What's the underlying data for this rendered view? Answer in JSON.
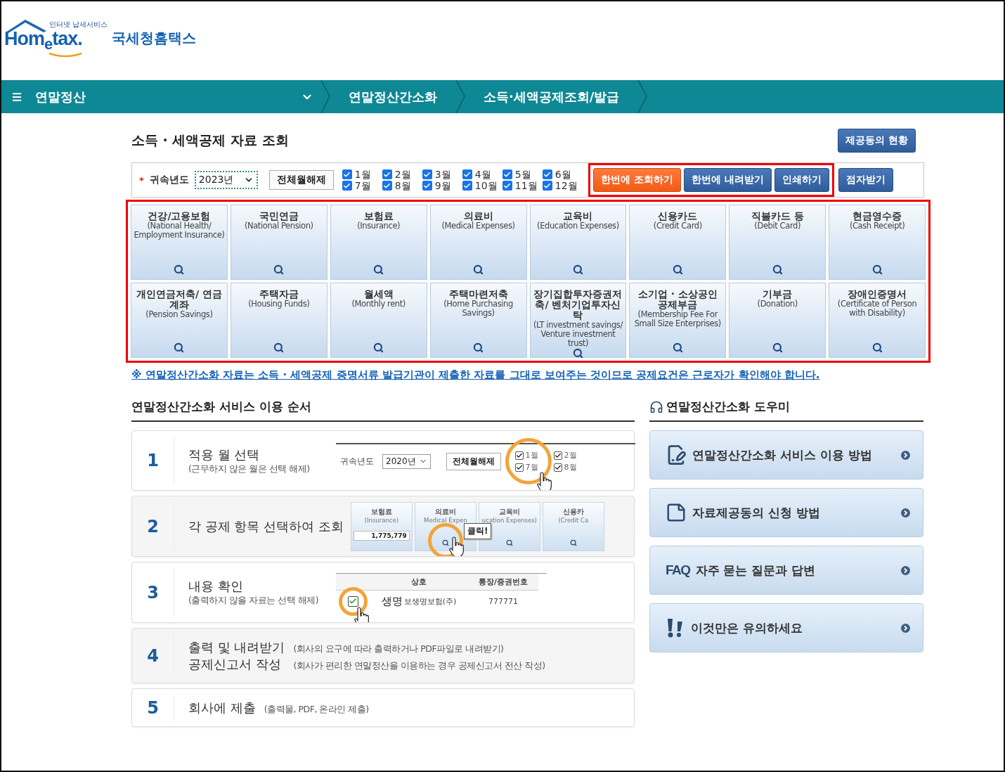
{
  "logo": {
    "tagline": "인터넷 납세서비스",
    "wordmark": "Hom$_{e}$tax.",
    "name": "국세청홈택스"
  },
  "nav": {
    "menu": "연말정산",
    "crumbs": [
      "연말정산간소화",
      "소득·세액공제조회/발급"
    ]
  },
  "page": {
    "title": "소득 · 세액공제 자료 조회",
    "consent_button": "제공동의 현황"
  },
  "filter": {
    "required_mark": "*",
    "year_label": "귀속년도",
    "year": "2023년",
    "reset_button": "전체월해제",
    "months": [
      {
        "label": "1월",
        "checked": true
      },
      {
        "label": "2월",
        "checked": true
      },
      {
        "label": "3월",
        "checked": true
      },
      {
        "label": "4월",
        "checked": true
      },
      {
        "label": "5월",
        "checked": true
      },
      {
        "label": "6월",
        "checked": true
      },
      {
        "label": "7월",
        "checked": true
      },
      {
        "label": "8월",
        "checked": true
      },
      {
        "label": "9월",
        "checked": true
      },
      {
        "label": "10월",
        "checked": true
      },
      {
        "label": "11월",
        "checked": true
      },
      {
        "label": "12월",
        "checked": true
      }
    ],
    "highlighted_actions": [
      {
        "kind": "primary",
        "label": "한번에 조회하기"
      },
      {
        "kind": "secondary",
        "label": "한번에 내려받기"
      },
      {
        "kind": "secondary",
        "label": "인쇄하기"
      }
    ],
    "braille_button": "점자받기"
  },
  "categories": [
    {
      "title": "건강/고용보험",
      "subtitle": "(National Health/ Employment Insurance)"
    },
    {
      "title": "국민연금",
      "subtitle": "(National Pension)"
    },
    {
      "title": "보험료",
      "subtitle": "(Insurance)"
    },
    {
      "title": "의료비",
      "subtitle": "(Medical Expenses)"
    },
    {
      "title": "교육비",
      "subtitle": "(Education Expenses)"
    },
    {
      "title": "신용카드",
      "subtitle": "(Credit Card)"
    },
    {
      "title": "직불카드 등",
      "subtitle": "(Debit Card)"
    },
    {
      "title": "현금영수증",
      "subtitle": "(Cash Receipt)"
    },
    {
      "title": "개인연금저축/ 연금계좌",
      "subtitle": "(Pension Savings)"
    },
    {
      "title": "주택자금",
      "subtitle": "(Housing Funds)"
    },
    {
      "title": "월세액",
      "subtitle": "(Monthly rent)"
    },
    {
      "title": "주택마련저축",
      "subtitle": "(Home Purchasing Savings)"
    },
    {
      "title": "장기집합투자증권저축/ 벤처기업투자신탁",
      "subtitle": "(LT investment savings/ Venture investment trust)"
    },
    {
      "title": "소기업 · 소상공인 공제부금",
      "subtitle": "(Membership Fee For Small Size Enterprises)"
    },
    {
      "title": "기부금",
      "subtitle": "(Donation)"
    },
    {
      "title": "장애인증명서",
      "subtitle": "(Certificate of Person with Disability)"
    }
  ],
  "notice": "※ 연말정산간소화 자료는 소득 · 세액공제 증명서류 발급기관이 제출한 자료를 그대로 보여주는 것이므로 공제요건은 근로자가 확인해야 합니다.",
  "steps_section": {
    "title": "연말정산간소화 서비스 이용 순서",
    "steps": [
      {
        "number": "1",
        "kind": "illustrated",
        "title": "적용 월 선택",
        "note": "(근무하지 않은 월은 선택 해제)",
        "illustration": {
          "kind": "months",
          "year_label": "귀속년도",
          "year": "2020년",
          "reset": "전체월해제",
          "months": [
            {
              "label": "1월",
              "checked": true
            },
            {
              "label": "7월",
              "checked": true
            },
            {
              "label": "2월",
              "checked": true
            },
            {
              "label": "8월",
              "checked": true
            }
          ]
        }
      },
      {
        "number": "2",
        "kind": "illustrated",
        "title": "각 공제 항목 선택하여 조회",
        "illustration": {
          "kind": "tiles",
          "callout": "클릭!",
          "tiles": [
            {
              "title": "보험료",
              "subtitle": "(Insurance)",
              "amount": "1,775,779"
            },
            {
              "title": "의료비",
              "subtitle": "Medical Expen"
            },
            {
              "title": "교육비",
              "subtitle": "ucation Expenses)"
            },
            {
              "title": "신용카",
              "subtitle": "(Credit Ca"
            }
          ]
        }
      },
      {
        "number": "3",
        "kind": "illustrated",
        "title": "내용 확인",
        "note": "(출력하지 않을 자료는 선택 해제)",
        "illustration": {
          "kind": "table",
          "headers": [
            "상호",
            "통장/증권번호"
          ],
          "rows": [
            {
              "checked": true,
              "zoomed": "생명",
              "name": "보생명보험(주)",
              "account": "777771"
            }
          ]
        }
      },
      {
        "number": "4",
        "kind": "lines",
        "lines": [
          {
            "title": "출력 및 내려받기",
            "note": "(회사의 요구에 따라 출력하거나 PDF파일로 내려받기)"
          },
          {
            "title": "공제신고서 작성",
            "note": "(회사가 편리한 연말정산을 이용하는 경우 공제신고서 전산 작성)"
          }
        ]
      },
      {
        "number": "5",
        "kind": "lines",
        "lines": [
          {
            "title": "회사에 제출",
            "note": "(출력물, PDF, 온라인 제출)"
          }
        ]
      }
    ]
  },
  "help_section": {
    "title": "연말정산간소화 도우미",
    "items": [
      {
        "kind": "manual",
        "label": "연말정산간소화 서비스 이용 방법"
      },
      {
        "kind": "form",
        "label": "자료제공동의 신청 방법"
      },
      {
        "kind": "faq",
        "badge": "FAQ",
        "label": "자주 묻는 질문과 답변"
      },
      {
        "kind": "alert",
        "label": "이것만은 유의하세요"
      }
    ]
  }
}
